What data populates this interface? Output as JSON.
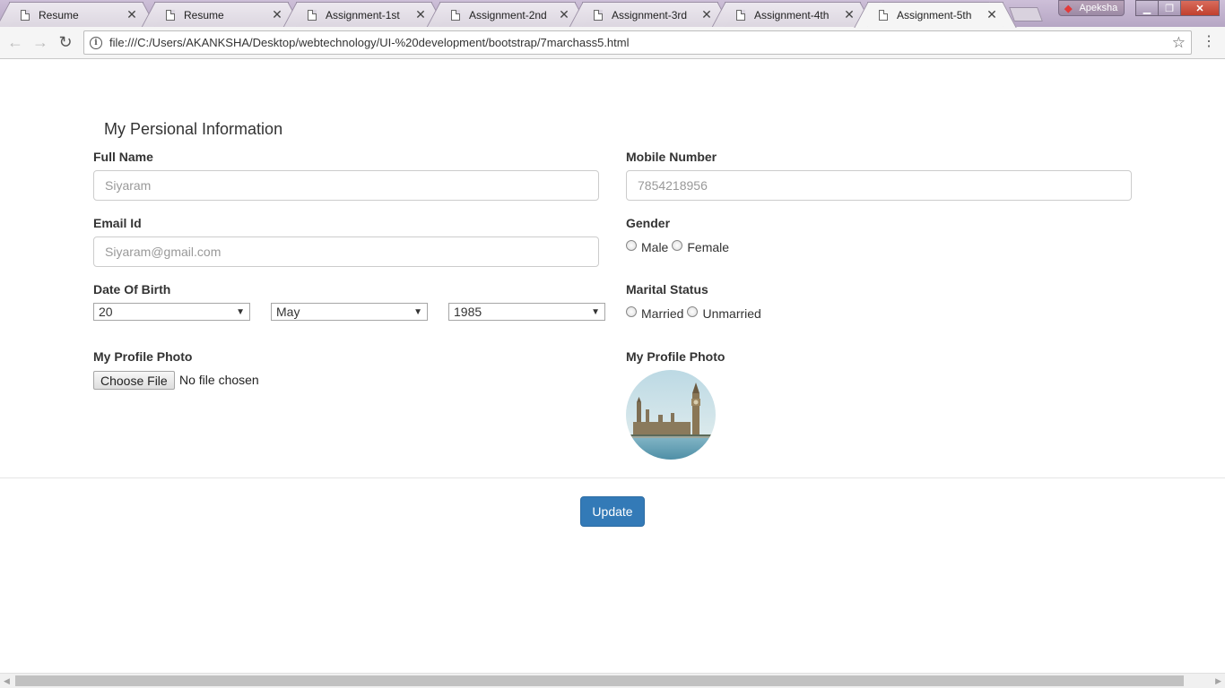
{
  "browser": {
    "tabs": [
      {
        "title": "Resume"
      },
      {
        "title": "Resume"
      },
      {
        "title": "Assignment-1st"
      },
      {
        "title": "Assignment-2nd"
      },
      {
        "title": "Assignment-3rd"
      },
      {
        "title": "Assignment-4th"
      },
      {
        "title": "Assignment-5th",
        "active": true
      }
    ],
    "profile_name": "Apeksha",
    "url": "file:///C:/Users/AKANKSHA/Desktop/webtechnology/UI-%20development/bootstrap/7marchass5.html"
  },
  "form": {
    "section_title": "My Persional Information",
    "full_name": {
      "label": "Full Name",
      "placeholder": "Siyaram"
    },
    "mobile": {
      "label": "Mobile Number",
      "placeholder": "7854218956"
    },
    "email": {
      "label": "Email Id",
      "placeholder": "Siyaram@gmail.com"
    },
    "gender": {
      "label": "Gender",
      "options": [
        "Male",
        "Female"
      ]
    },
    "dob": {
      "label": "Date Of Birth",
      "day": "20",
      "month": "May",
      "year": "1985"
    },
    "marital": {
      "label": "Marital Status",
      "options": [
        "Married",
        "Unmarried"
      ]
    },
    "photo_upload": {
      "label": "My Profile Photo",
      "button": "Choose File",
      "status": "No file chosen"
    },
    "photo_preview": {
      "label": "My Profile Photo"
    },
    "update_button": "Update"
  },
  "colors": {
    "primary_button": "#337ab7",
    "tabstrip": "#b6a6c4"
  },
  "icons": [
    "back-arrow-icon",
    "forward-arrow-icon",
    "reload-icon",
    "info-icon",
    "star-icon",
    "menu-icon",
    "document-icon",
    "close-icon"
  ]
}
